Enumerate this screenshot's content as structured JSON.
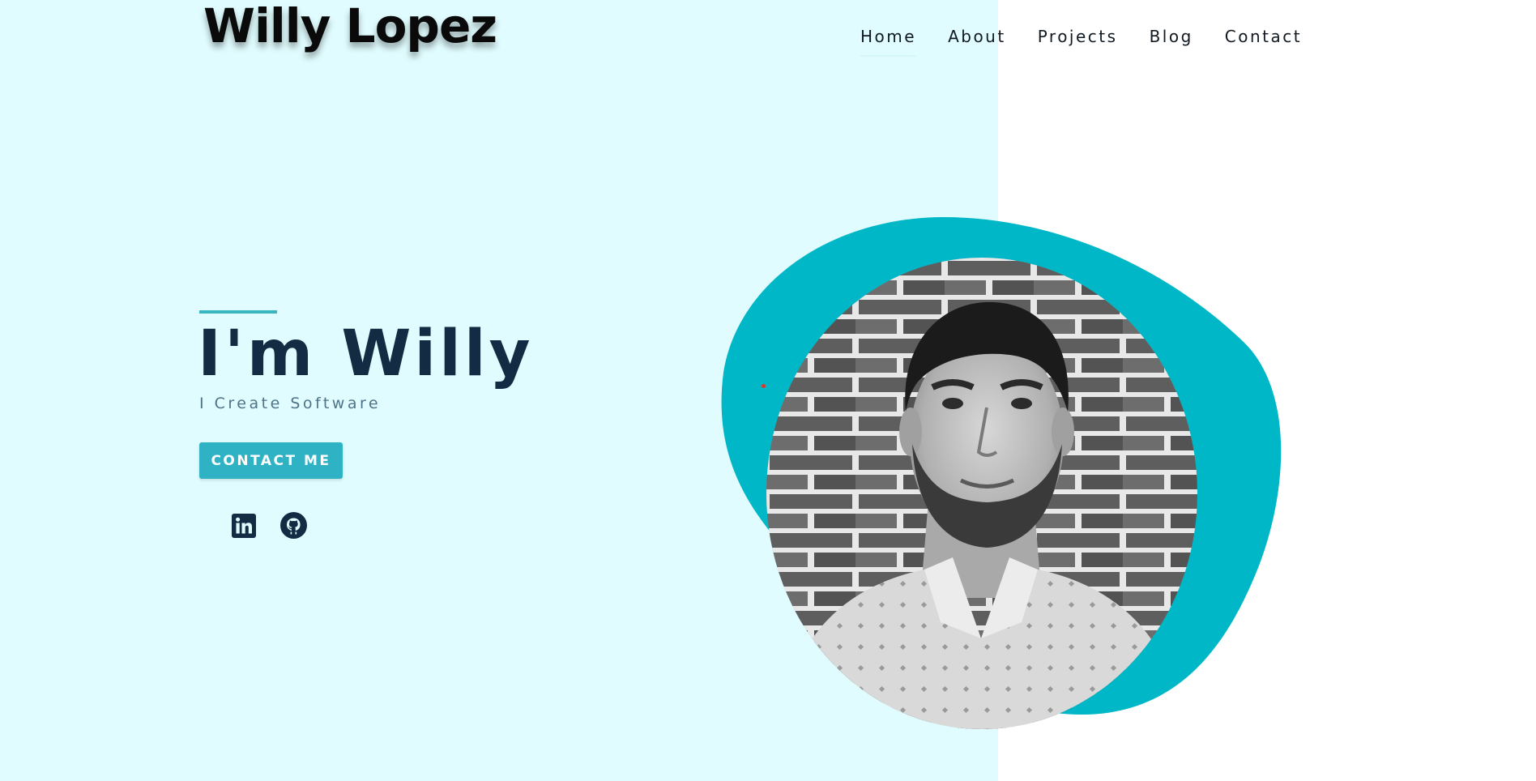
{
  "header": {
    "logo": "Willy Lopez",
    "nav": [
      {
        "label": "Home",
        "active": true
      },
      {
        "label": "About",
        "active": false
      },
      {
        "label": "Projects",
        "active": false
      },
      {
        "label": "Blog",
        "active": false
      },
      {
        "label": "Contact",
        "active": false
      }
    ]
  },
  "hero": {
    "title": "I'm Willy",
    "subtitle": "I Create Software",
    "cta_label": "CONTACT ME",
    "social": [
      {
        "name": "linkedin",
        "icon": "linkedin-icon"
      },
      {
        "name": "github",
        "icon": "github-icon"
      }
    ],
    "portrait": "profile-photo"
  },
  "colors": {
    "left_background": "#e0fcfe",
    "right_background": "#ffffff",
    "accent": "#2fb3c4",
    "blob": "#00b7c7",
    "heading": "#132c44",
    "subtitle": "#4f7389"
  }
}
